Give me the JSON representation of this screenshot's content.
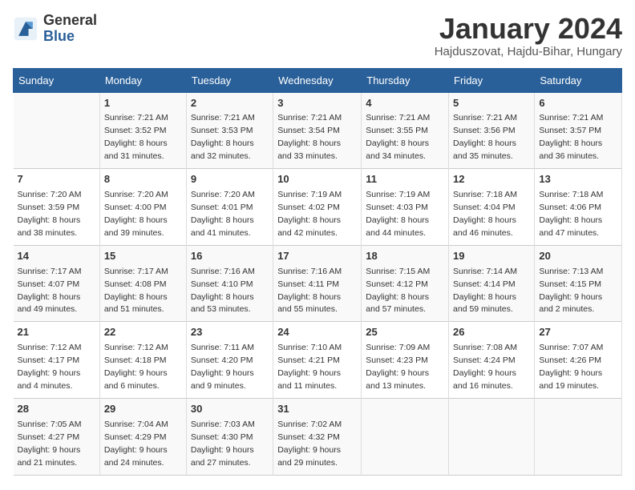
{
  "logo": {
    "general": "General",
    "blue": "Blue"
  },
  "title": "January 2024",
  "location": "Hajduszovat, Hajdu-Bihar, Hungary",
  "days_header": [
    "Sunday",
    "Monday",
    "Tuesday",
    "Wednesday",
    "Thursday",
    "Friday",
    "Saturday"
  ],
  "weeks": [
    [
      {
        "day": "",
        "sunrise": "",
        "sunset": "",
        "daylight": ""
      },
      {
        "day": "1",
        "sunrise": "Sunrise: 7:21 AM",
        "sunset": "Sunset: 3:52 PM",
        "daylight": "Daylight: 8 hours and 31 minutes."
      },
      {
        "day": "2",
        "sunrise": "Sunrise: 7:21 AM",
        "sunset": "Sunset: 3:53 PM",
        "daylight": "Daylight: 8 hours and 32 minutes."
      },
      {
        "day": "3",
        "sunrise": "Sunrise: 7:21 AM",
        "sunset": "Sunset: 3:54 PM",
        "daylight": "Daylight: 8 hours and 33 minutes."
      },
      {
        "day": "4",
        "sunrise": "Sunrise: 7:21 AM",
        "sunset": "Sunset: 3:55 PM",
        "daylight": "Daylight: 8 hours and 34 minutes."
      },
      {
        "day": "5",
        "sunrise": "Sunrise: 7:21 AM",
        "sunset": "Sunset: 3:56 PM",
        "daylight": "Daylight: 8 hours and 35 minutes."
      },
      {
        "day": "6",
        "sunrise": "Sunrise: 7:21 AM",
        "sunset": "Sunset: 3:57 PM",
        "daylight": "Daylight: 8 hours and 36 minutes."
      }
    ],
    [
      {
        "day": "7",
        "sunrise": "Sunrise: 7:20 AM",
        "sunset": "Sunset: 3:59 PM",
        "daylight": "Daylight: 8 hours and 38 minutes."
      },
      {
        "day": "8",
        "sunrise": "Sunrise: 7:20 AM",
        "sunset": "Sunset: 4:00 PM",
        "daylight": "Daylight: 8 hours and 39 minutes."
      },
      {
        "day": "9",
        "sunrise": "Sunrise: 7:20 AM",
        "sunset": "Sunset: 4:01 PM",
        "daylight": "Daylight: 8 hours and 41 minutes."
      },
      {
        "day": "10",
        "sunrise": "Sunrise: 7:19 AM",
        "sunset": "Sunset: 4:02 PM",
        "daylight": "Daylight: 8 hours and 42 minutes."
      },
      {
        "day": "11",
        "sunrise": "Sunrise: 7:19 AM",
        "sunset": "Sunset: 4:03 PM",
        "daylight": "Daylight: 8 hours and 44 minutes."
      },
      {
        "day": "12",
        "sunrise": "Sunrise: 7:18 AM",
        "sunset": "Sunset: 4:04 PM",
        "daylight": "Daylight: 8 hours and 46 minutes."
      },
      {
        "day": "13",
        "sunrise": "Sunrise: 7:18 AM",
        "sunset": "Sunset: 4:06 PM",
        "daylight": "Daylight: 8 hours and 47 minutes."
      }
    ],
    [
      {
        "day": "14",
        "sunrise": "Sunrise: 7:17 AM",
        "sunset": "Sunset: 4:07 PM",
        "daylight": "Daylight: 8 hours and 49 minutes."
      },
      {
        "day": "15",
        "sunrise": "Sunrise: 7:17 AM",
        "sunset": "Sunset: 4:08 PM",
        "daylight": "Daylight: 8 hours and 51 minutes."
      },
      {
        "day": "16",
        "sunrise": "Sunrise: 7:16 AM",
        "sunset": "Sunset: 4:10 PM",
        "daylight": "Daylight: 8 hours and 53 minutes."
      },
      {
        "day": "17",
        "sunrise": "Sunrise: 7:16 AM",
        "sunset": "Sunset: 4:11 PM",
        "daylight": "Daylight: 8 hours and 55 minutes."
      },
      {
        "day": "18",
        "sunrise": "Sunrise: 7:15 AM",
        "sunset": "Sunset: 4:12 PM",
        "daylight": "Daylight: 8 hours and 57 minutes."
      },
      {
        "day": "19",
        "sunrise": "Sunrise: 7:14 AM",
        "sunset": "Sunset: 4:14 PM",
        "daylight": "Daylight: 8 hours and 59 minutes."
      },
      {
        "day": "20",
        "sunrise": "Sunrise: 7:13 AM",
        "sunset": "Sunset: 4:15 PM",
        "daylight": "Daylight: 9 hours and 2 minutes."
      }
    ],
    [
      {
        "day": "21",
        "sunrise": "Sunrise: 7:12 AM",
        "sunset": "Sunset: 4:17 PM",
        "daylight": "Daylight: 9 hours and 4 minutes."
      },
      {
        "day": "22",
        "sunrise": "Sunrise: 7:12 AM",
        "sunset": "Sunset: 4:18 PM",
        "daylight": "Daylight: 9 hours and 6 minutes."
      },
      {
        "day": "23",
        "sunrise": "Sunrise: 7:11 AM",
        "sunset": "Sunset: 4:20 PM",
        "daylight": "Daylight: 9 hours and 9 minutes."
      },
      {
        "day": "24",
        "sunrise": "Sunrise: 7:10 AM",
        "sunset": "Sunset: 4:21 PM",
        "daylight": "Daylight: 9 hours and 11 minutes."
      },
      {
        "day": "25",
        "sunrise": "Sunrise: 7:09 AM",
        "sunset": "Sunset: 4:23 PM",
        "daylight": "Daylight: 9 hours and 13 minutes."
      },
      {
        "day": "26",
        "sunrise": "Sunrise: 7:08 AM",
        "sunset": "Sunset: 4:24 PM",
        "daylight": "Daylight: 9 hours and 16 minutes."
      },
      {
        "day": "27",
        "sunrise": "Sunrise: 7:07 AM",
        "sunset": "Sunset: 4:26 PM",
        "daylight": "Daylight: 9 hours and 19 minutes."
      }
    ],
    [
      {
        "day": "28",
        "sunrise": "Sunrise: 7:05 AM",
        "sunset": "Sunset: 4:27 PM",
        "daylight": "Daylight: 9 hours and 21 minutes."
      },
      {
        "day": "29",
        "sunrise": "Sunrise: 7:04 AM",
        "sunset": "Sunset: 4:29 PM",
        "daylight": "Daylight: 9 hours and 24 minutes."
      },
      {
        "day": "30",
        "sunrise": "Sunrise: 7:03 AM",
        "sunset": "Sunset: 4:30 PM",
        "daylight": "Daylight: 9 hours and 27 minutes."
      },
      {
        "day": "31",
        "sunrise": "Sunrise: 7:02 AM",
        "sunset": "Sunset: 4:32 PM",
        "daylight": "Daylight: 9 hours and 29 minutes."
      },
      {
        "day": "",
        "sunrise": "",
        "sunset": "",
        "daylight": ""
      },
      {
        "day": "",
        "sunrise": "",
        "sunset": "",
        "daylight": ""
      },
      {
        "day": "",
        "sunrise": "",
        "sunset": "",
        "daylight": ""
      }
    ]
  ]
}
